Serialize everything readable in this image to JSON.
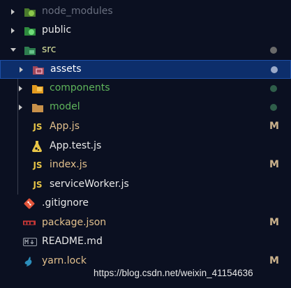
{
  "explorer": {
    "items": [
      {
        "name": "node_modules",
        "kind": "folder",
        "expanded": false,
        "color": "#6a7080",
        "status": ""
      },
      {
        "name": "public",
        "kind": "folder",
        "expanded": false,
        "color": "#e8e8e8",
        "status": ""
      },
      {
        "name": "src",
        "kind": "folder",
        "expanded": true,
        "color": "#dde6a0",
        "status": "dot"
      },
      {
        "name": "assets",
        "kind": "folder",
        "expanded": false,
        "color": "#ffffff",
        "status": "dot",
        "selected": true
      },
      {
        "name": "components",
        "kind": "folder",
        "expanded": false,
        "color": "#5fb55b",
        "status": "dot"
      },
      {
        "name": "model",
        "kind": "folder",
        "expanded": false,
        "color": "#5fb55b",
        "status": "dot"
      },
      {
        "name": "App.js",
        "kind": "file",
        "color": "#e2c08d",
        "status": "M"
      },
      {
        "name": "App.test.js",
        "kind": "file",
        "color": "#e8e8e8",
        "status": ""
      },
      {
        "name": "index.js",
        "kind": "file",
        "color": "#e2c08d",
        "status": "M"
      },
      {
        "name": "serviceWorker.js",
        "kind": "file",
        "color": "#e8e8e8",
        "status": ""
      },
      {
        "name": ".gitignore",
        "kind": "file",
        "color": "#e8e8e8",
        "status": ""
      },
      {
        "name": "package.json",
        "kind": "file",
        "color": "#e2c08d",
        "status": "M"
      },
      {
        "name": "README.md",
        "kind": "file",
        "color": "#e8e8e8",
        "status": ""
      },
      {
        "name": "yarn.lock",
        "kind": "file",
        "color": "#e2c08d",
        "status": "M"
      }
    ],
    "icons": [
      "folder-node-icon",
      "folder-public-icon",
      "folder-src-icon",
      "folder-assets-icon",
      "folder-components-icon",
      "folder-model-icon",
      "js-icon",
      "test-js-icon",
      "js-icon",
      "js-icon",
      "git-icon",
      "npm-icon",
      "markdown-icon",
      "yarn-icon"
    ],
    "status_labels": {
      "modified": "M"
    },
    "dot_colors": {
      "src": "#6a6a6a",
      "assets": "#9aa9c9",
      "components": "#2f5e4a",
      "model": "#2f5e4a"
    },
    "js_label": "JS"
  },
  "watermark": "https://blog.csdn.net/weixin_41154636"
}
